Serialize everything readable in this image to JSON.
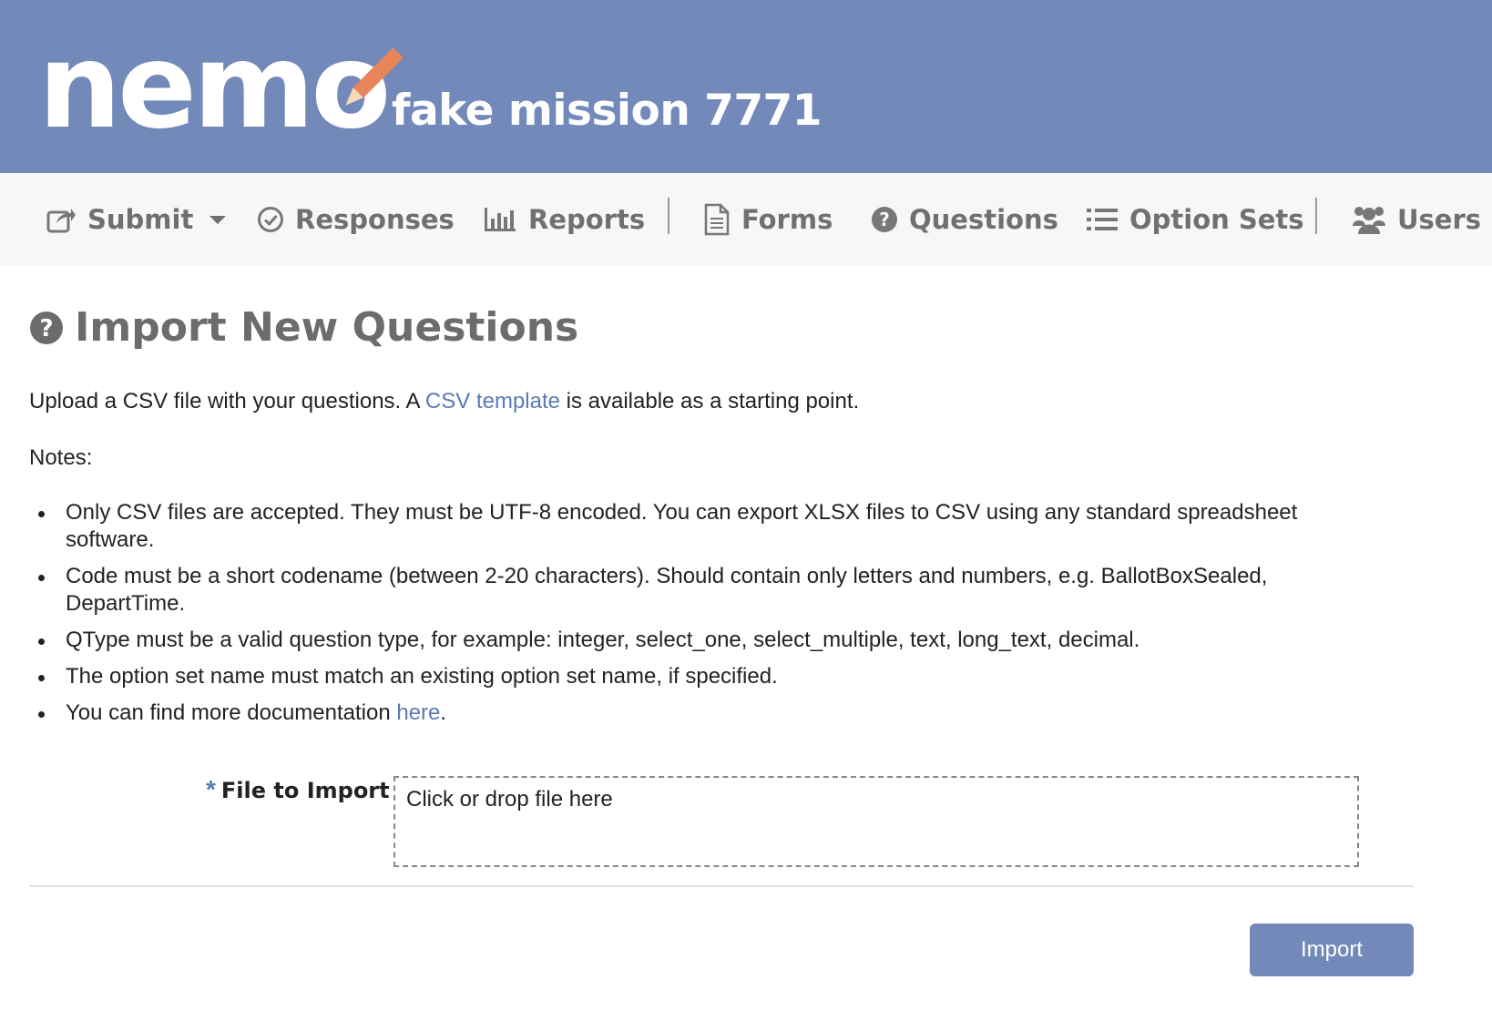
{
  "header": {
    "logo_text": "nemo",
    "mission_name": "fake mission 7771"
  },
  "nav": {
    "items": [
      {
        "label": "Submit",
        "icon": "share-icon",
        "has_dropdown": true
      },
      {
        "label": "Responses",
        "icon": "check-circle-icon"
      },
      {
        "label": "Reports",
        "icon": "bar-chart-icon"
      },
      {
        "label": "Forms",
        "icon": "document-icon"
      },
      {
        "label": "Questions",
        "icon": "question-circle-icon"
      },
      {
        "label": "Option Sets",
        "icon": "list-icon"
      },
      {
        "label": "Users",
        "icon": "users-icon"
      }
    ]
  },
  "page": {
    "title": "Import New Questions",
    "title_icon": "question-circle-icon",
    "intro_before": "Upload a CSV file with your questions. A ",
    "intro_link": "CSV template",
    "intro_after": " is available as a starting point.",
    "notes_label": "Notes:",
    "notes": [
      "Only CSV files are accepted. They must be UTF-8 encoded. You can export XLSX files to CSV using any standard spreadsheet software.",
      "Code must be a short codename (between 2-20 characters). Should contain only letters and numbers, e.g. BallotBoxSealed, DepartTime.",
      "QType must be a valid question type, for example: integer, select_one, select_multiple, text, long_text, decimal.",
      "The option set name must match an existing option set name, if specified."
    ],
    "last_note_before": "You can find more documentation ",
    "last_note_link": "here",
    "last_note_after": "."
  },
  "form": {
    "required_marker": "*",
    "file_label": "File to Import",
    "dropzone_text": "Click or drop file here",
    "submit_label": "Import"
  },
  "colors": {
    "header_bg": "#7289ba",
    "nav_bg": "#f7f7f8",
    "link": "#5b7ab5",
    "button": "#7289ba",
    "pencil": "#e8855a"
  }
}
